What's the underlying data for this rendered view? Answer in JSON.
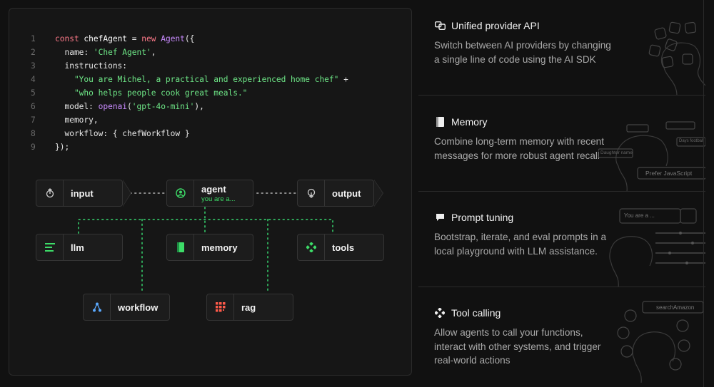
{
  "code": {
    "lines": [
      {
        "n": "1",
        "parts": [
          [
            "kw",
            "const "
          ],
          [
            "var",
            "chefAgent "
          ],
          [
            "punc",
            "= "
          ],
          [
            "kw",
            "new "
          ],
          [
            "fn",
            "Agent"
          ],
          [
            "punc",
            "({"
          ]
        ]
      },
      {
        "n": "2",
        "parts": [
          [
            "punc",
            "  name: "
          ],
          [
            "str",
            "'Chef Agent'"
          ],
          [
            "punc",
            ","
          ]
        ]
      },
      {
        "n": "3",
        "parts": [
          [
            "punc",
            "  instructions:"
          ]
        ]
      },
      {
        "n": "4",
        "parts": [
          [
            "str",
            "    \"You are Michel, a practical and experienced home chef\""
          ],
          [
            "punc",
            " +"
          ]
        ]
      },
      {
        "n": "5",
        "parts": [
          [
            "str",
            "    \"who helps people cook great meals.\""
          ]
        ]
      },
      {
        "n": "6",
        "parts": [
          [
            "punc",
            "  model: "
          ],
          [
            "fn",
            "openai"
          ],
          [
            "punc",
            "("
          ],
          [
            "str",
            "'gpt-4o-mini'"
          ],
          [
            "punc",
            "),"
          ]
        ]
      },
      {
        "n": "7",
        "parts": [
          [
            "punc",
            "  memory,"
          ]
        ]
      },
      {
        "n": "8",
        "parts": [
          [
            "punc",
            "  workflow: { chefWorkflow }"
          ]
        ]
      },
      {
        "n": "9",
        "parts": [
          [
            "punc",
            "});"
          ]
        ]
      }
    ]
  },
  "flow": {
    "input": {
      "label": "input",
      "icon": "input-icon"
    },
    "agent": {
      "label": "agent",
      "sub": "you are a...",
      "icon": "agent-icon"
    },
    "output": {
      "label": "output",
      "icon": "output-icon"
    },
    "llm": {
      "label": "llm",
      "icon": "llm-icon"
    },
    "memory": {
      "label": "memory",
      "icon": "memory-book-icon"
    },
    "tools": {
      "label": "tools",
      "icon": "tools-icon"
    },
    "workflow": {
      "label": "workflow",
      "icon": "workflow-icon"
    },
    "rag": {
      "label": "rag",
      "icon": "rag-grid-icon"
    }
  },
  "features": [
    {
      "title": "Unified provider API",
      "desc": "Switch between AI providers by changing a single line of code using the AI SDK",
      "icon": "provider-icon"
    },
    {
      "title": "Memory",
      "desc": "Combine long-term memory with recent messages for more robust agent recall",
      "icon": "memory-icon",
      "illus_text": [
        "Prefer JavaScript",
        "Days football",
        "Daughter name"
      ]
    },
    {
      "title": "Prompt tuning",
      "desc": "Bootstrap, iterate, and eval prompts in a local playground with LLM assistance.",
      "icon": "prompt-icon",
      "illus_text": [
        "You are a ..."
      ]
    },
    {
      "title": "Tool calling",
      "desc": "Allow agents to call your functions, interact with other systems, and trigger real-world actions",
      "icon": "tool-calling-icon",
      "illus_text": [
        "searchAmazon"
      ]
    }
  ],
  "colors": {
    "green": "#3ddc68",
    "dot_green": "#2fa85a",
    "pink": "#ff7a8a",
    "purple": "#c98bff",
    "bg": "#111111"
  }
}
